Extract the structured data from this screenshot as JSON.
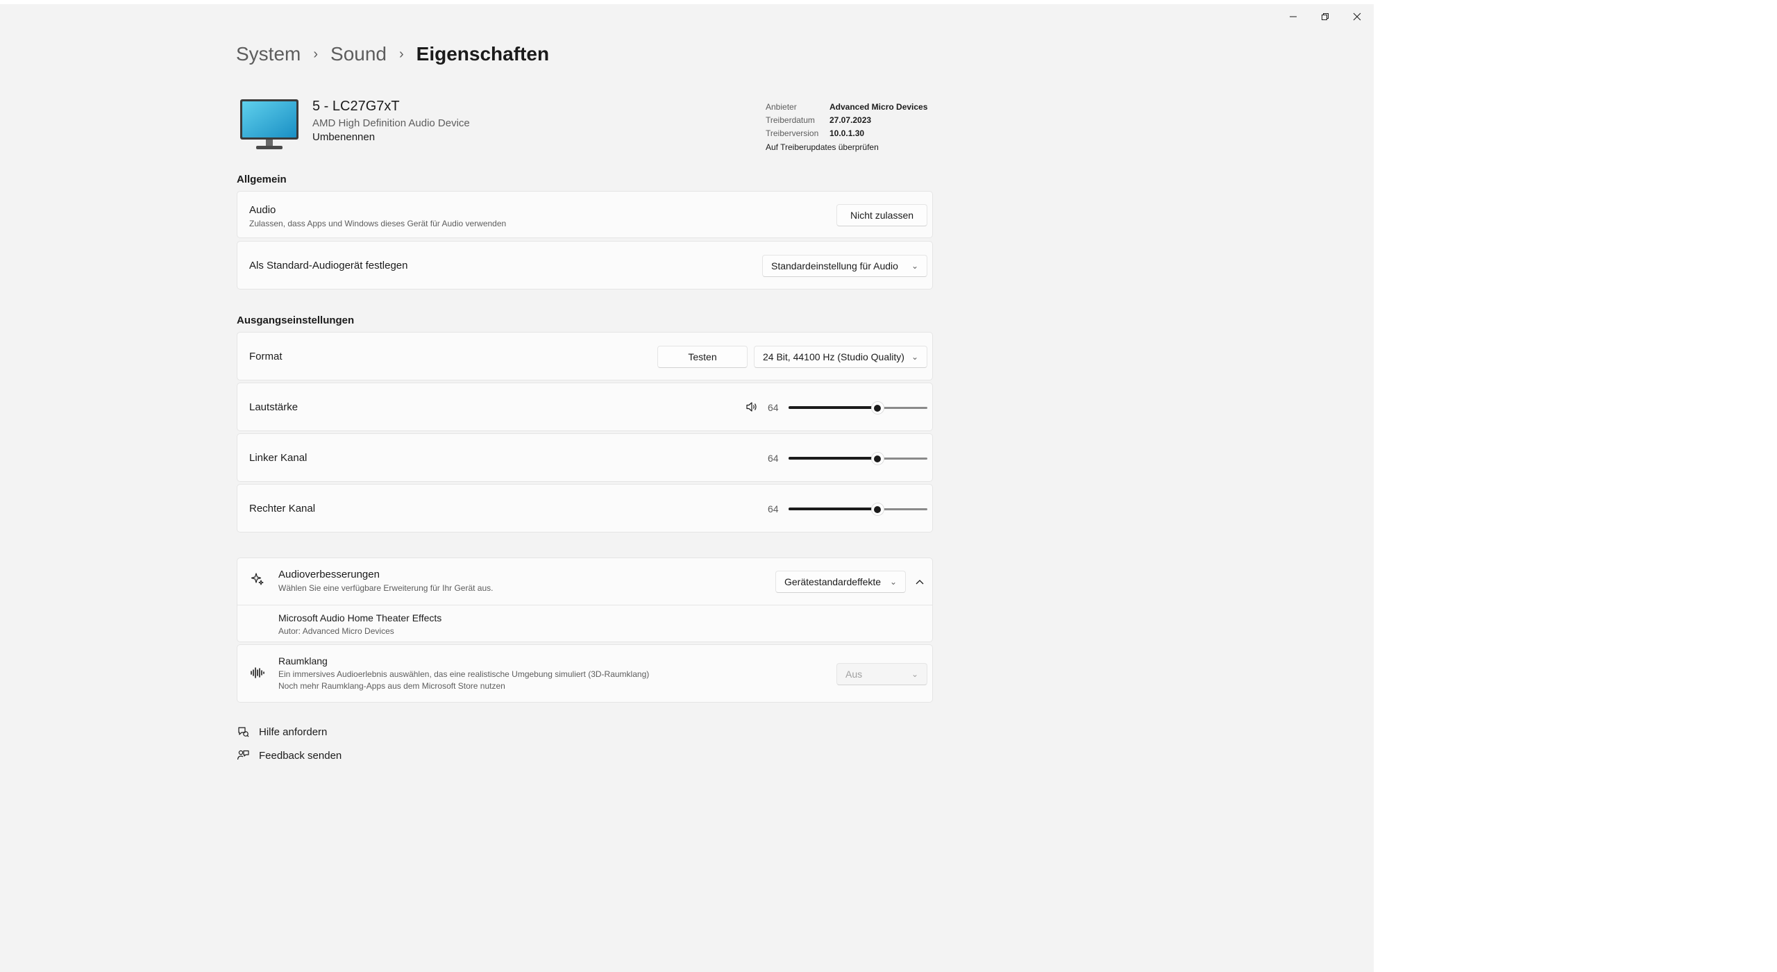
{
  "window": {
    "minimize_icon": "minimize-icon",
    "restore_icon": "restore-icon",
    "close_icon": "close-icon"
  },
  "breadcrumb": {
    "system": "System",
    "sound": "Sound",
    "current": "Eigenschaften",
    "separator": "›"
  },
  "device": {
    "name": "5 - LC27G7xT",
    "driver_name": "AMD High Definition Audio Device",
    "rename": "Umbenennen",
    "props": [
      {
        "key": "Anbieter",
        "value": "Advanced Micro Devices"
      },
      {
        "key": "Treiberdatum",
        "value": "27.07.2023"
      },
      {
        "key": "Treiberversion",
        "value": "10.0.1.30"
      }
    ],
    "check_updates": "Auf Treiberupdates überprüfen"
  },
  "general": {
    "title": "Allgemein",
    "audio_label": "Audio",
    "audio_sub": "Zulassen, dass Apps und Windows dieses Gerät für Audio verwenden",
    "audio_button": "Nicht zulassen",
    "default_label": "Als Standard-Audiogerät festlegen",
    "default_value": "Standardeinstellung für Audio"
  },
  "output": {
    "title": "Ausgangseinstellungen",
    "format_label": "Format",
    "test_button": "Testen",
    "format_value": "24 Bit, 44100 Hz (Studio Quality)",
    "volume_label": "Lautstärke",
    "volume_value": "64",
    "volume_level": 64,
    "left_label": "Linker Kanal",
    "left_value": "64",
    "left_level": 64,
    "right_label": "Rechter Kanal",
    "right_value": "64",
    "right_level": 64
  },
  "enhancements": {
    "label": "Audioverbesserungen",
    "sub": "Wählen Sie eine verfügbare Erweiterung für Ihr Gerät aus.",
    "value": "Gerätestandardeffekte",
    "effect_name": "Microsoft Audio Home Theater Effects",
    "effect_author": "Autor: Advanced Micro Devices"
  },
  "spatial": {
    "label": "Raumklang",
    "sub": "Ein immersives Audioerlebnis auswählen, das eine realistische Umgebung simuliert (3D-Raumklang)",
    "store_link": "Noch mehr Raumklang-Apps aus dem Microsoft Store nutzen",
    "value": "Aus"
  },
  "footer": {
    "help": "Hilfe anfordern",
    "feedback": "Feedback senden"
  },
  "colors": {
    "accent": "#1b1b1b",
    "background": "#f3f3f3",
    "card": "#fbfbfb"
  }
}
